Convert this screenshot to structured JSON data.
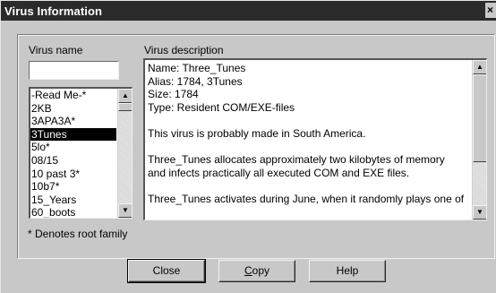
{
  "window": {
    "title": "Virus Information",
    "close_glyph": "×"
  },
  "search": {
    "label": "Virus name",
    "value": ""
  },
  "virus_list": {
    "items": [
      "-Read Me-*",
      "2KB",
      "3APA3A*",
      "3Tunes",
      "5lo*",
      "08/15",
      "10 past 3*",
      "10b7*",
      "15_Years",
      "60_boots"
    ],
    "selected_index": 3
  },
  "description": {
    "label": "Virus description",
    "lines": [
      "Name: Three_Tunes",
      "Alias: 1784, 3Tunes",
      "Size: 1784",
      "Type: Resident  COM/EXE-files",
      "",
      "This virus is probably made in South America.",
      "",
      "Three_Tunes allocates approximately two kilobytes of memory",
      "and infects practically all executed COM and EXE files.",
      "",
      "Three_Tunes activates during June, when it randomly plays one of"
    ]
  },
  "footnote": "* Denotes root family",
  "buttons": {
    "close": {
      "label": "Close"
    },
    "copy": {
      "mnemonic": "C",
      "rest": "opy"
    },
    "help": {
      "label": "Help"
    }
  },
  "icons": {
    "close": "close-icon",
    "scroll_up": "up-arrow-icon",
    "scroll_down": "down-arrow-icon"
  }
}
